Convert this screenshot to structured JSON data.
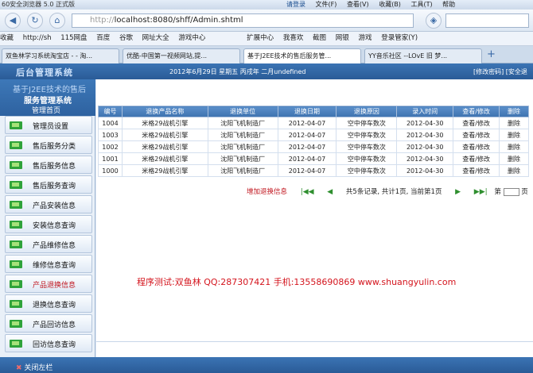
{
  "browser": {
    "title": "60安全浏览器 5.0 正式版",
    "login_link": "请登录",
    "menus": [
      "文件(F)",
      "查看(V)",
      "收藏(B)",
      "工具(T)",
      "帮助"
    ],
    "address_prefix": "http://",
    "address": "localhost:8080/shff/Admin.shtml",
    "bookmarks": [
      "收藏",
      "http://sh",
      "115网盘",
      "百度",
      "谷歌",
      "网址大全",
      "游戏中心",
      "扩展中心",
      "我喜欢",
      "截图",
      "网银",
      "游戏",
      "登录管家(Y)"
    ],
    "tabs": [
      "双鱼林学习系统淘宝店 - - 淘...",
      "优酷-中国第一视频网站,提...",
      "基于J2EE技术的售后服务管...",
      "YY音乐社区 --LOvE 旧 梦..."
    ]
  },
  "app": {
    "logo": "后台管理系统",
    "date": "2012年6月29日  星期五  丙戌年  二月undefined",
    "links": "[修改密码] [安全退",
    "nav_title_line1": "基于J2EE技术的售后",
    "nav_title_line2": "服务管理系统",
    "nav_home": "管理首页",
    "nav_items": [
      "管理员设置",
      "售后服务分类",
      "售后服务信息",
      "售后服务查询",
      "产品安装信息",
      "安装信息查询",
      "产品维修信息",
      "维修信息查询",
      "产品退换信息",
      "退换信息查询",
      "产品回访信息",
      "回访信息查询"
    ],
    "selected_nav": "产品退换信息",
    "close_bar": "关闭左栏"
  },
  "table": {
    "headers": [
      "编号",
      "退换产品名称",
      "退换单位",
      "退换日期",
      "退换原因",
      "录入时间",
      "查看/修改",
      "删除"
    ],
    "rows": [
      [
        "1004",
        "米格29战机引擎",
        "沈阳飞机制造厂",
        "2012-04-07",
        "空中停车数次",
        "2012-04-30",
        "查看/修改",
        "删除"
      ],
      [
        "1003",
        "米格29战机引擎",
        "沈阳飞机制造厂",
        "2012-04-07",
        "空中停车数次",
        "2012-04-30",
        "查看/修改",
        "删除"
      ],
      [
        "1002",
        "米格29战机引擎",
        "沈阳飞机制造厂",
        "2012-04-07",
        "空中停车数次",
        "2012-04-30",
        "查看/修改",
        "删除"
      ],
      [
        "1001",
        "米格29战机引擎",
        "沈阳飞机制造厂",
        "2012-04-07",
        "空中停车数次",
        "2012-04-30",
        "查看/修改",
        "删除"
      ],
      [
        "1000",
        "米格29战机引擎",
        "沈阳飞机制造厂",
        "2012-04-07",
        "空中停车数次",
        "2012-04-30",
        "查看/修改",
        "删除"
      ]
    ]
  },
  "pager": {
    "add_label": "增加退换信息",
    "summary": "共5条记录, 共计1页, 当前第1页",
    "page_prefix": "第",
    "page_suffix": "页"
  },
  "contact": "程序测试:双鱼林 QQ:287307421 手机:13558690869 www.shuangyulin.com"
}
